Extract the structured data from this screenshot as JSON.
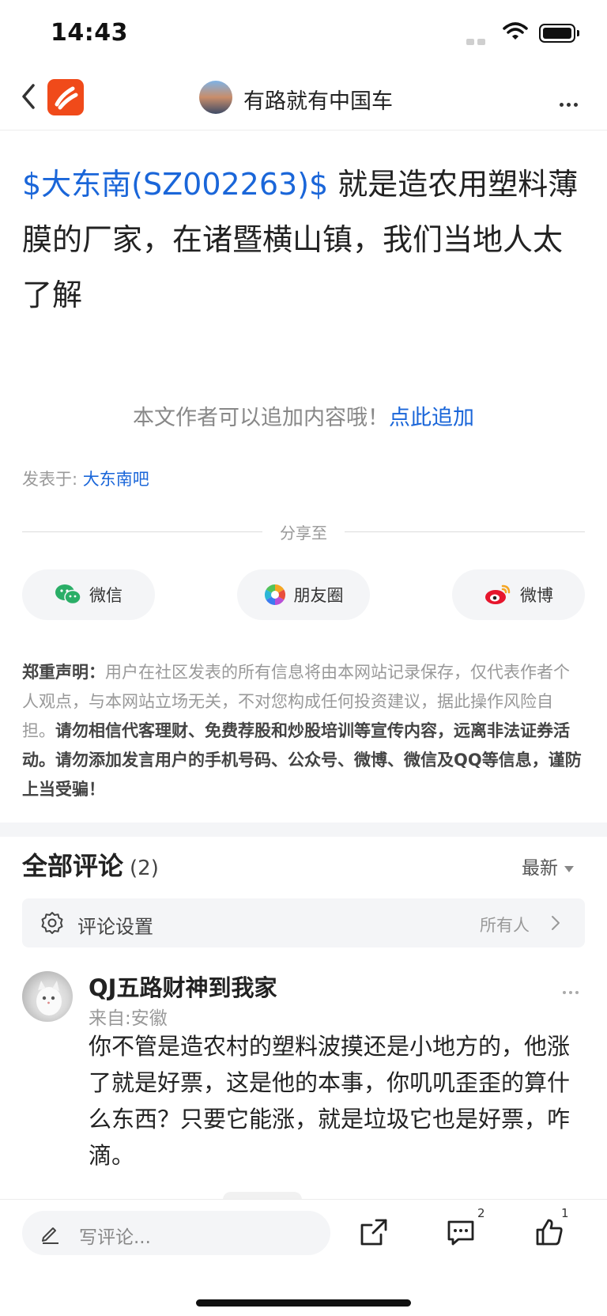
{
  "status": {
    "time": "14:43"
  },
  "nav": {
    "title": "有路就有中国车"
  },
  "post": {
    "stock_tag": "$大东南(SZ002263)$",
    "body": " 就是造农用塑料薄膜的厂家，在诸暨横山镇，我们当地人太了解",
    "append_text": "本文作者可以追加内容哦！",
    "append_link": "点此追加",
    "posted_in_label": "发表于: ",
    "posted_in_link": "大东南吧"
  },
  "share": {
    "label": "分享至",
    "buttons": [
      {
        "label": "微信"
      },
      {
        "label": "朋友圈"
      },
      {
        "label": "微博"
      }
    ]
  },
  "disclaimer": {
    "title": "郑重声明：",
    "normal": "用户在社区发表的所有信息将由本网站记录保存，仅代表作者个人观点，与本网站立场无关，不对您构成任何投资建议，据此操作风险自担。",
    "bold": "请勿相信代客理财、免费荐股和炒股培训等宣传内容，远离非法证券活动。请勿添加发言用户的手机号码、公众号、微博、微信及QQ等信息，谨防上当受骗！"
  },
  "comments": {
    "title": "全部评论",
    "count": "(2)",
    "sort_label": "最新",
    "settings_label": "评论设置",
    "settings_value": "所有人",
    "items": [
      {
        "user": "QJ五路财神到我家",
        "location": "来自:安徽",
        "text": "你不管是造农村的塑料波摸还是小地方的，他涨了就是好票，这是他的本事，你叽叽歪歪的算什么东西？只要它能涨，就是垃圾它也是好票，咋滴。"
      }
    ]
  },
  "bottom_bar": {
    "placeholder": "写评论...",
    "comment_badge": "2",
    "like_badge": "1"
  }
}
